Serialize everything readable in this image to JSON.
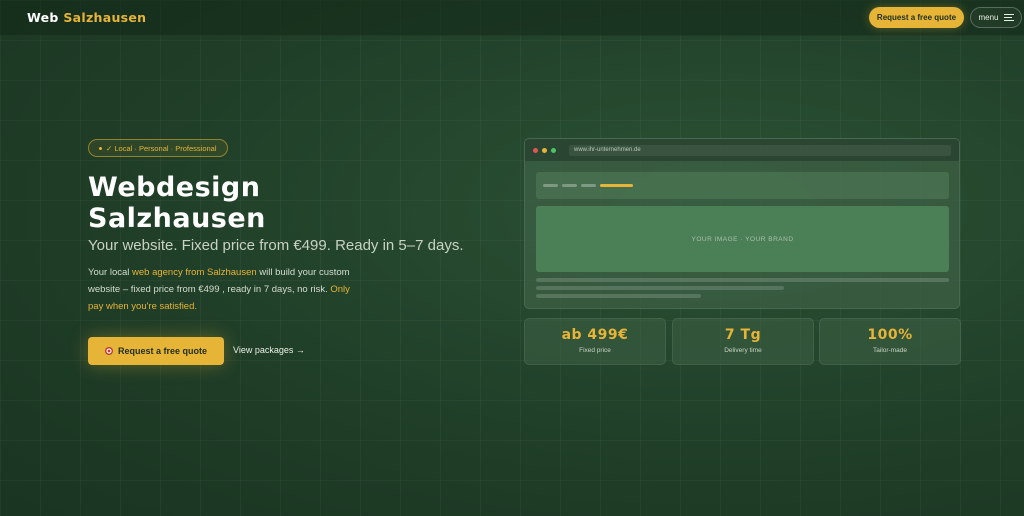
{
  "header": {
    "logo_part1": "Web",
    "logo_part2": "Salzhausen",
    "cta_label": "Request a free quote",
    "menu_label": "menu"
  },
  "hero": {
    "badge": "✓ Local · Personal · Professional",
    "title_line1": "Webdesign",
    "title_line2": "Salzhausen",
    "subtitle": "Your website. Fixed price from €499. Ready in 5–7 days.",
    "desc_part1": "Your local ",
    "desc_link": "web agency from Salzhausen",
    "desc_part2": " will build your custom website – fixed price from €499 , ready in 7 days, no risk. ",
    "desc_highlight": "Only pay when you're satisfied.",
    "cta_label": "Request a free quote",
    "packages_link": "View packages →"
  },
  "mockup": {
    "url": "www.ihr-unternehmen.de",
    "image_placeholder": "YOUR IMAGE · YOUR BRAND"
  },
  "stats": [
    {
      "value": "ab 499€",
      "label": "Fixed price"
    },
    {
      "value": "7 Tg",
      "label": "Delivery time"
    },
    {
      "value": "100%",
      "label": "Tailor-made"
    }
  ],
  "colors": {
    "background": "#1f3d27",
    "accent": "#e6b437",
    "traffic_red": "#e0574f",
    "traffic_yellow": "#e6b437",
    "traffic_green": "#4fc36b"
  }
}
